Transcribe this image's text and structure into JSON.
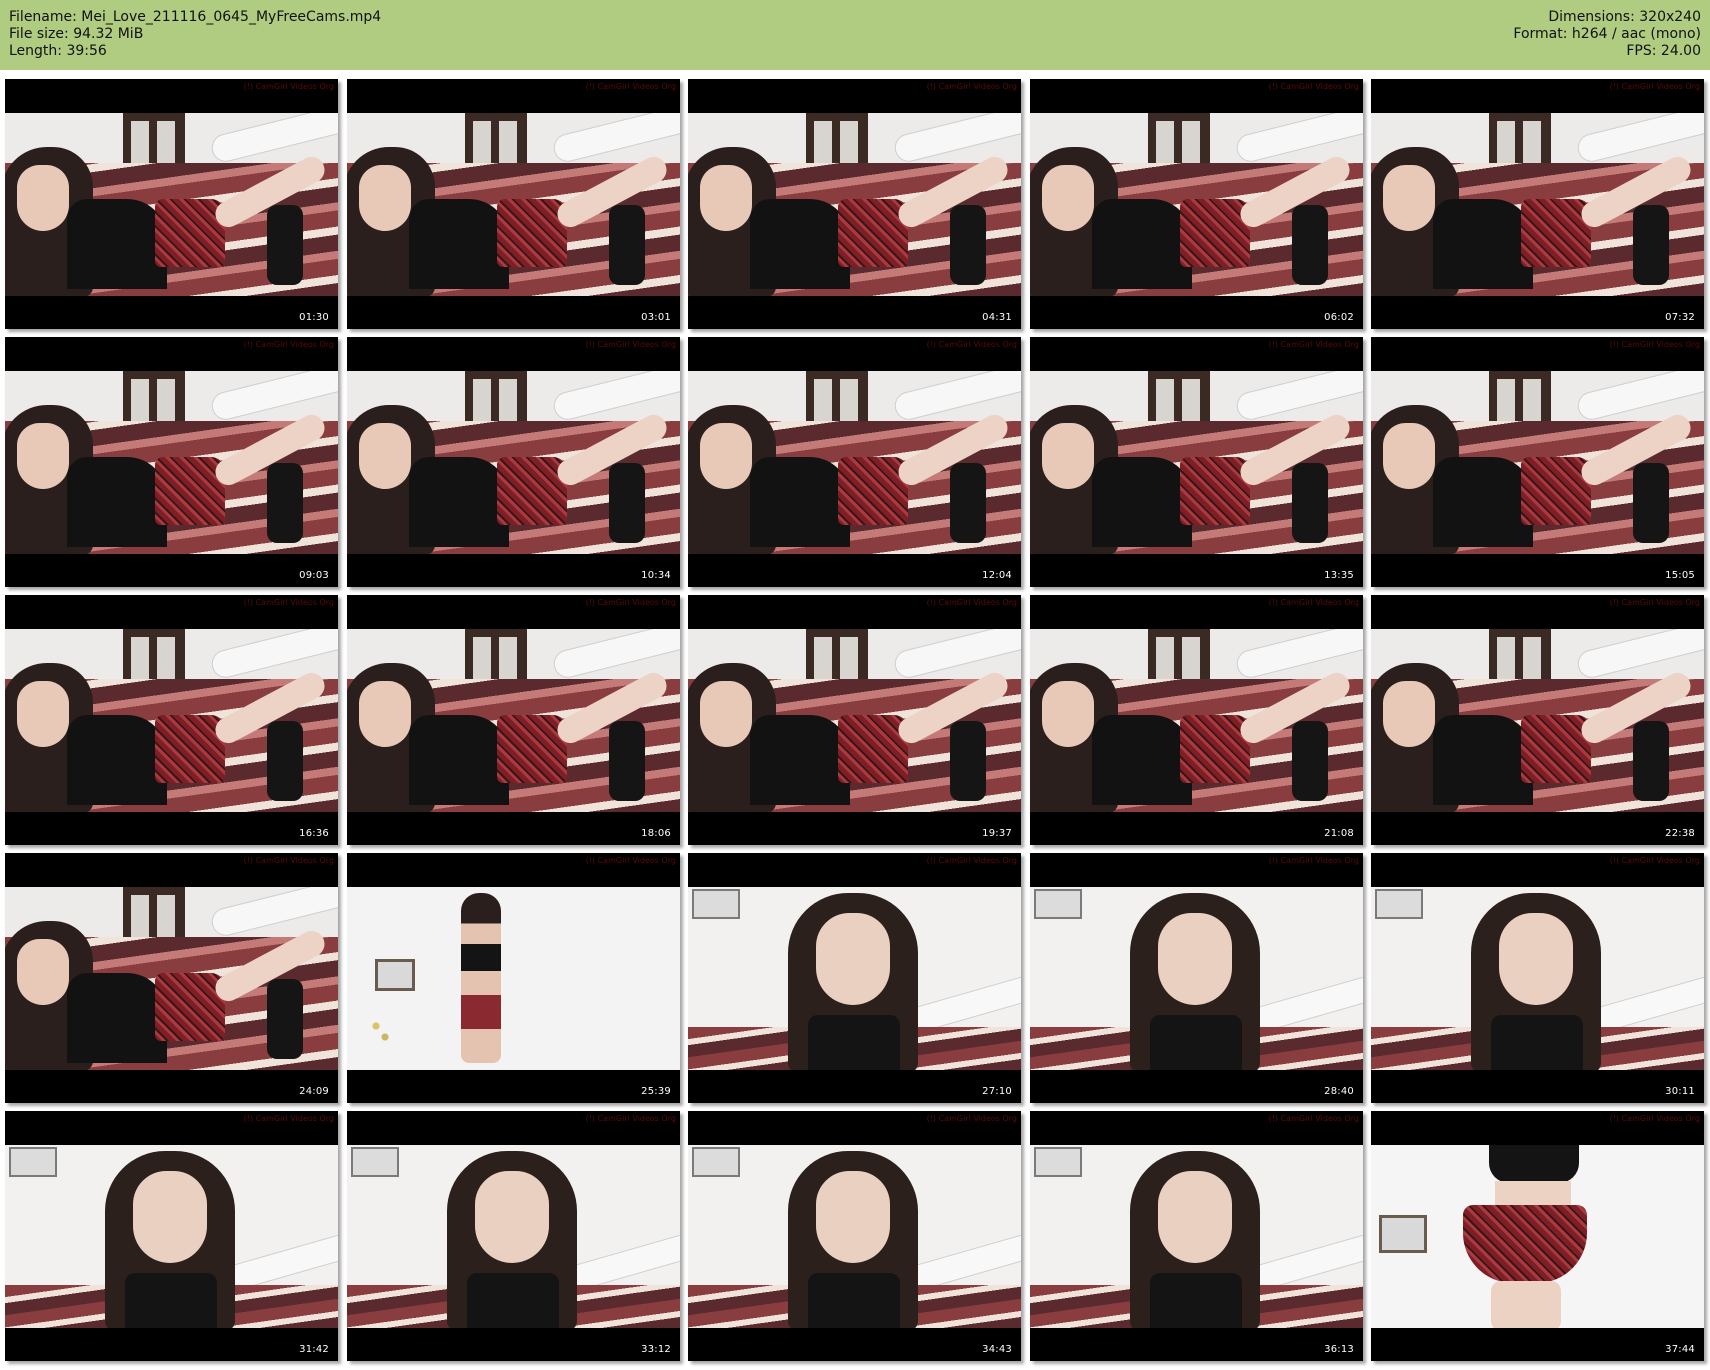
{
  "header": {
    "filename": "Filename: Mei_Love_211116_0645_MyFreeCams.mp4",
    "filesize": "File size: 94.32 MiB",
    "length": "Length: 39:56",
    "dimensions": "Dimensions: 320x240",
    "format": "Format: h264 / aac (mono)",
    "fps": "FPS: 24.00"
  },
  "watermark": "(!) CamGirl Videos Org",
  "thumbnails": [
    {
      "timestamp": "01:30",
      "scene": "bed"
    },
    {
      "timestamp": "03:01",
      "scene": "bed"
    },
    {
      "timestamp": "04:31",
      "scene": "bed"
    },
    {
      "timestamp": "06:02",
      "scene": "bed"
    },
    {
      "timestamp": "07:32",
      "scene": "bed"
    },
    {
      "timestamp": "09:03",
      "scene": "bed"
    },
    {
      "timestamp": "10:34",
      "scene": "bed"
    },
    {
      "timestamp": "12:04",
      "scene": "bed"
    },
    {
      "timestamp": "13:35",
      "scene": "bed"
    },
    {
      "timestamp": "15:05",
      "scene": "bed"
    },
    {
      "timestamp": "16:36",
      "scene": "bed"
    },
    {
      "timestamp": "18:06",
      "scene": "bed"
    },
    {
      "timestamp": "19:37",
      "scene": "bed"
    },
    {
      "timestamp": "21:08",
      "scene": "bed"
    },
    {
      "timestamp": "22:38",
      "scene": "bed"
    },
    {
      "timestamp": "24:09",
      "scene": "bed"
    },
    {
      "timestamp": "25:39",
      "scene": "room"
    },
    {
      "timestamp": "27:10",
      "scene": "close"
    },
    {
      "timestamp": "28:40",
      "scene": "close"
    },
    {
      "timestamp": "30:11",
      "scene": "close"
    },
    {
      "timestamp": "31:42",
      "scene": "close"
    },
    {
      "timestamp": "33:12",
      "scene": "close"
    },
    {
      "timestamp": "34:43",
      "scene": "close"
    },
    {
      "timestamp": "36:13",
      "scene": "close"
    },
    {
      "timestamp": "37:44",
      "scene": "twirl"
    }
  ],
  "colors": {
    "header_bg": "#b0cc80",
    "thumb_bg": "#000000",
    "timestamp": "#ffffff"
  }
}
